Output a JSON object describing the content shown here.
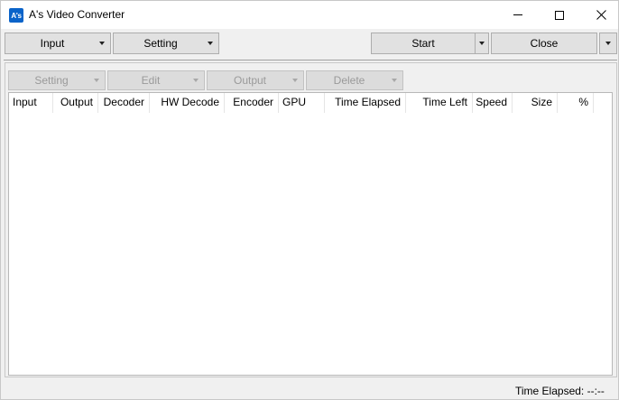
{
  "window": {
    "title": "A's Video Converter",
    "icon_text": "A's",
    "minimize_icon": "minimize-icon",
    "maximize_icon": "maximize-icon",
    "close_icon": "close-icon"
  },
  "toolbar": {
    "input_label": "Input",
    "setting_label": "Setting",
    "start_label": "Start",
    "close_label": "Close"
  },
  "subtoolbar": {
    "setting_label": "Setting",
    "edit_label": "Edit",
    "output_label": "Output",
    "delete_label": "Delete"
  },
  "table": {
    "columns": [
      "Input",
      "Output",
      "Decoder",
      "HW Decode",
      "Encoder",
      "GPU",
      "Time Elapsed",
      "Time Left",
      "Speed",
      "Size",
      "%"
    ],
    "rows": []
  },
  "status": {
    "time_elapsed": "Time Elapsed: --:--"
  }
}
